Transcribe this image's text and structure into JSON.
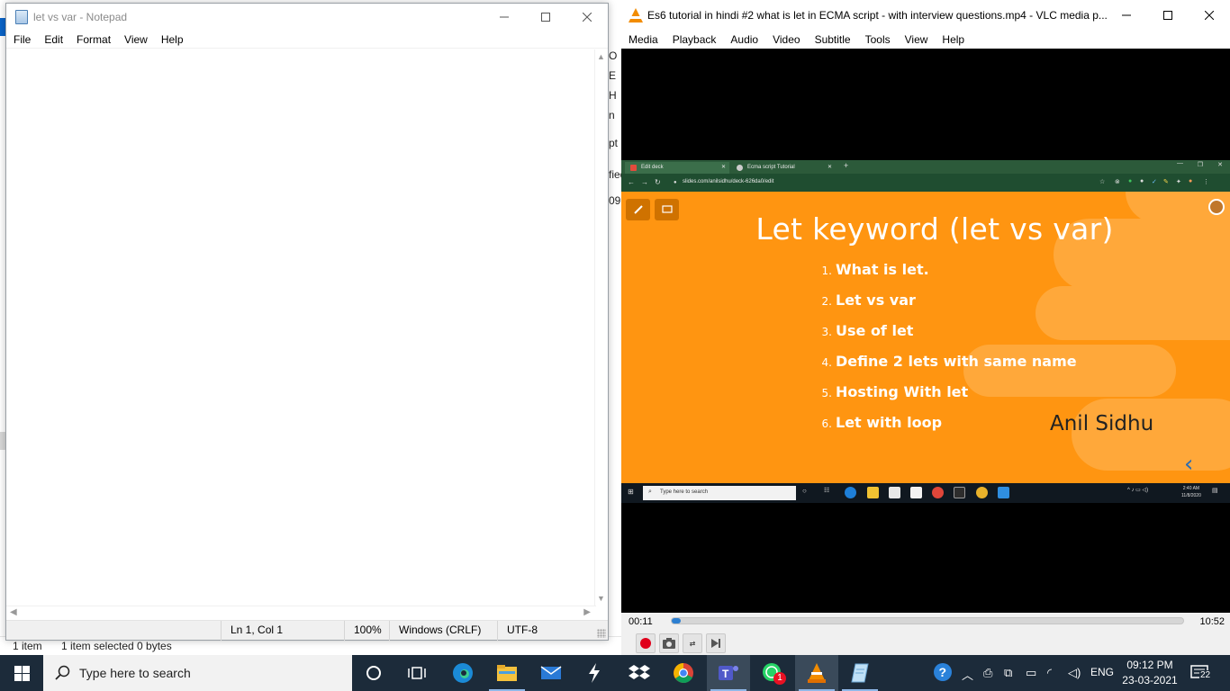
{
  "explorer": {
    "fragments": [
      "O",
      "E",
      "H",
      "n",
      "pt",
      "fied",
      "09"
    ],
    "status_items": "1 item",
    "status_selected": "1 item selected  0 bytes"
  },
  "notepad": {
    "title": "let vs var - Notepad",
    "menu": [
      "File",
      "Edit",
      "Format",
      "View",
      "Help"
    ],
    "content": "",
    "status": {
      "position": "Ln 1, Col 1",
      "zoom": "100%",
      "line_ending": "Windows (CRLF)",
      "encoding": "UTF-8"
    }
  },
  "vlc": {
    "title": "Es6 tutorial in hindi #2 what is let in ECMA script - with interview questions.mp4 - VLC media p...",
    "menu": [
      "Media",
      "Playback",
      "Audio",
      "Video",
      "Subtitle",
      "Tools",
      "View",
      "Help"
    ],
    "time_current": "00:11",
    "time_total": "10:52",
    "progress": 0.017
  },
  "video": {
    "tabs": [
      "Edit deck",
      "Ecma script Tutorial"
    ],
    "url": "slides.com/anilsidhu/deck-626da0/edit",
    "slide": {
      "title": "Let keyword (let vs var)",
      "items": [
        {
          "num": "1.",
          "text": "What is let."
        },
        {
          "num": "2.",
          "text": "Let vs var"
        },
        {
          "num": "3.",
          "text": "Use of let"
        },
        {
          "num": "4.",
          "text": "Define 2 lets with same name"
        },
        {
          "num": "5.",
          "text": "Hosting With let"
        },
        {
          "num": "6.",
          "text": "Let with loop"
        }
      ],
      "author": "Anil Sidhu"
    },
    "taskbar": {
      "search": "Type here to search",
      "time": "2:40 AM",
      "date": "11/8/2020"
    }
  },
  "taskbar": {
    "search_placeholder": "Type here to search",
    "whatsapp_badge": "1",
    "language": "ENG",
    "time": "09:12 PM",
    "date": "23-03-2021",
    "notifications": "22"
  },
  "colors": {
    "slide_orange": "#ff9511",
    "vlc_orange": "#f28c00",
    "taskbar": "#1c2b3a",
    "seek_fill": "#2c7fd1"
  }
}
